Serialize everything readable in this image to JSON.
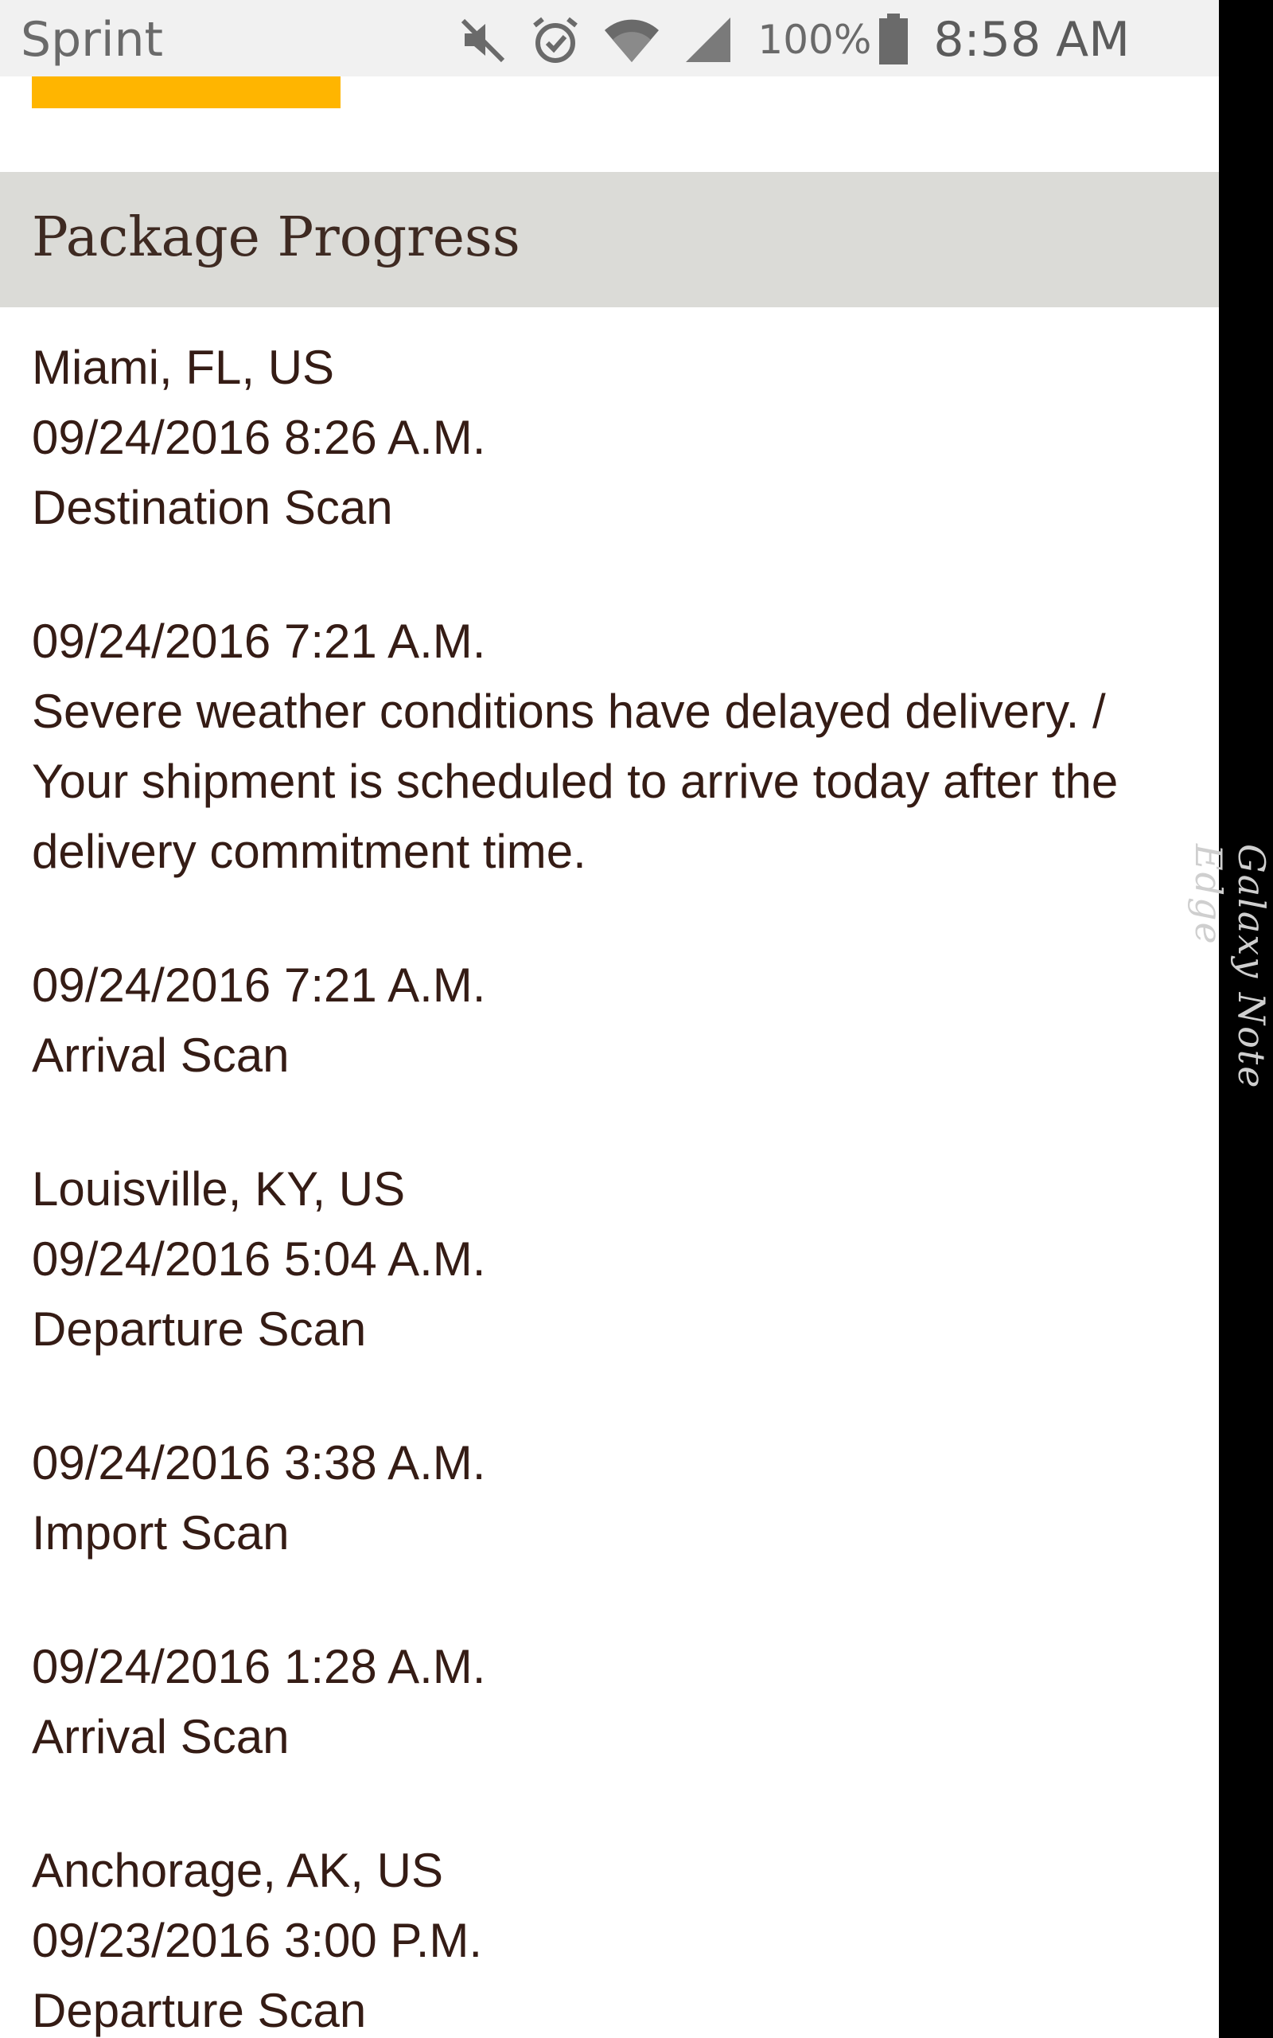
{
  "status_bar": {
    "carrier": "Sprint",
    "icons": [
      "mute-icon",
      "alarm-icon",
      "wifi-icon",
      "signal-icon",
      "battery-icon"
    ],
    "battery_percent": "100%",
    "time": "8:58 AM"
  },
  "accent_color": "#ffb500",
  "section": {
    "title": "Package Progress"
  },
  "progress": [
    {
      "location": "Miami, FL, US",
      "events": [
        {
          "datetime": "09/24/2016 8:26 A.M.",
          "activity": "Destination Scan"
        },
        {
          "datetime": "09/24/2016 7:21 A.M.",
          "activity": "Severe weather conditions have delayed delivery. / Your shipment is scheduled to arrive today after the delivery commitment time."
        },
        {
          "datetime": "09/24/2016 7:21 A.M.",
          "activity": "Arrival Scan"
        }
      ]
    },
    {
      "location": "Louisville, KY, US",
      "events": [
        {
          "datetime": "09/24/2016 5:04 A.M.",
          "activity": "Departure Scan"
        },
        {
          "datetime": "09/24/2016 3:38 A.M.",
          "activity": "Import Scan"
        },
        {
          "datetime": "09/24/2016 1:28 A.M.",
          "activity": "Arrival Scan"
        }
      ]
    },
    {
      "location": "Anchorage, AK, US",
      "events": [
        {
          "datetime": "09/23/2016 3:00 P.M.",
          "activity": "Departure Scan"
        }
      ]
    }
  ],
  "edge_panel": {
    "label": "Galaxy Note Edge"
  }
}
